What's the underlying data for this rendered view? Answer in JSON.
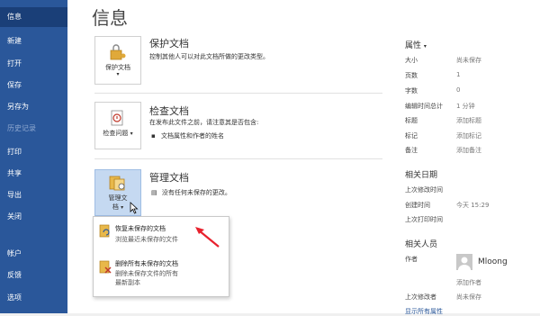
{
  "sidebar": {
    "items": [
      {
        "label": "信息",
        "active": true
      },
      {
        "label": "新建"
      },
      {
        "label": "打开"
      },
      {
        "label": "保存"
      },
      {
        "label": "另存为"
      },
      {
        "label": "历史记录",
        "disabled": true
      },
      {
        "label": "打印"
      },
      {
        "label": "共享"
      },
      {
        "label": "导出"
      },
      {
        "label": "关闭"
      },
      {
        "label": "帐户"
      },
      {
        "label": "反馈"
      },
      {
        "label": "选项"
      }
    ]
  },
  "main": {
    "title": "信息",
    "protect": {
      "button": "保护文档",
      "title": "保护文档",
      "desc": "控制其他人可以对此文档所做的更改类型。"
    },
    "inspect": {
      "button": "检查问题",
      "title": "检查文档",
      "desc": "在发布此文件之前，请注意其是否包含:",
      "bullet": "文档属性和作者的姓名"
    },
    "manage": {
      "button_line1": "管理文",
      "button_line2": "档",
      "title": "管理文档",
      "desc": "没有任何未保存的更改。"
    },
    "popup": {
      "opt1_title": "恢复未保存的文档",
      "opt1_sub": "浏览最近未保存的文件",
      "opt2_title": "删除所有未保存的文档",
      "opt2_sub_line1": "删除未保存文件的所有",
      "opt2_sub_line2": "最新副本"
    }
  },
  "properties": {
    "header": "属性",
    "rows": [
      {
        "label": "大小",
        "value": "尚未保存"
      },
      {
        "label": "页数",
        "value": "1"
      },
      {
        "label": "字数",
        "value": "0"
      },
      {
        "label": "编辑时间总计",
        "value": "1 分钟"
      },
      {
        "label": "标题",
        "value": "添加标题"
      },
      {
        "label": "标记",
        "value": "添加标记"
      },
      {
        "label": "备注",
        "value": "添加备注"
      }
    ],
    "dates_header": "相关日期",
    "dates": [
      {
        "label": "上次修改时间",
        "value": ""
      },
      {
        "label": "创建时间",
        "value": "今天 15:29"
      },
      {
        "label": "上次打印时间",
        "value": ""
      }
    ],
    "people_header": "相关人员",
    "author_label": "作者",
    "author_name": "Mloong",
    "add_author": "添加作者",
    "last_modified_label": "上次修改者",
    "last_modified_value": "尚未保存",
    "show_all": "显示所有属性"
  },
  "colors": {
    "sidebar": "#2a579a",
    "accent": "#1a3f78",
    "arrow": "#e8212d"
  }
}
